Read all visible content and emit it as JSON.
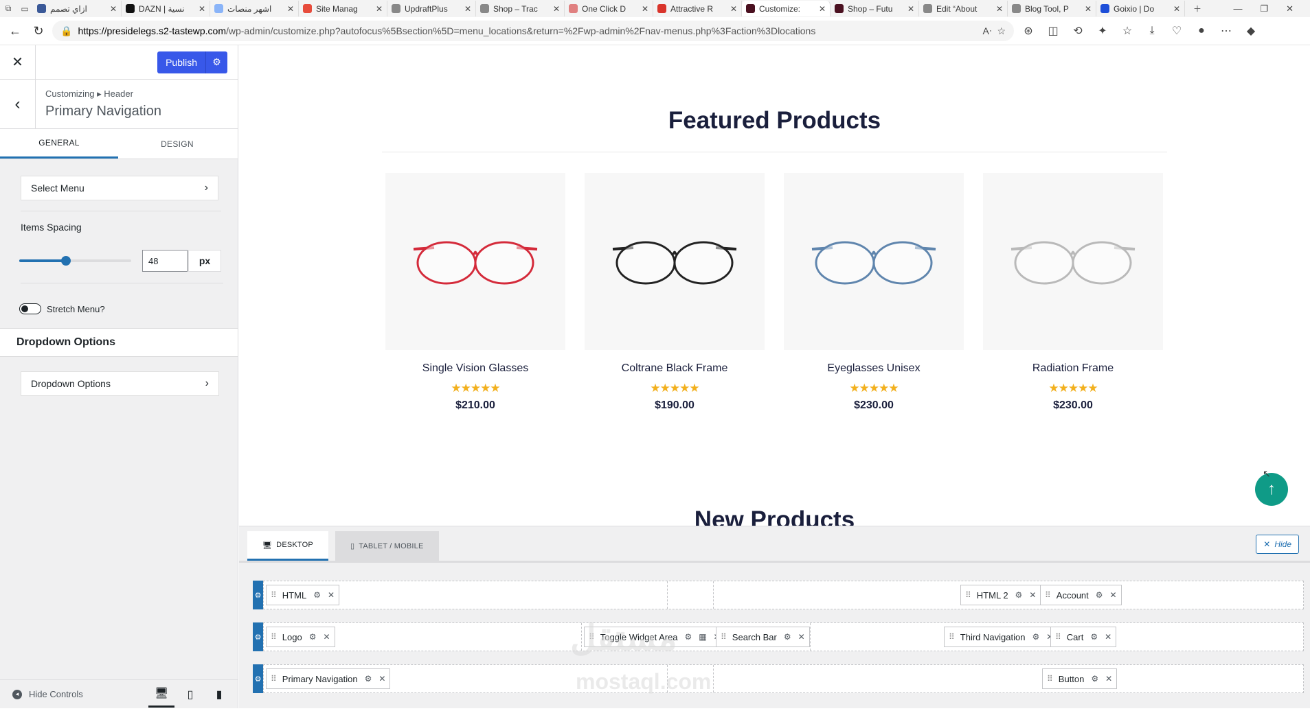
{
  "browser": {
    "tabs": [
      {
        "label": "ازاي تصمم",
        "color": "#3b5998"
      },
      {
        "label": "DAZN | نسية",
        "color": "#111111"
      },
      {
        "label": "اشهر منصات",
        "color": "#8ab4f8"
      },
      {
        "label": "Site Manag",
        "color": "#e74c3c"
      },
      {
        "label": "UpdraftPlus",
        "color": "#888888"
      },
      {
        "label": "Shop – Trac",
        "color": "#888888"
      },
      {
        "label": "One Click D",
        "color": "#e08080"
      },
      {
        "label": "Attractive R",
        "color": "#d9342b"
      },
      {
        "label": "Customize:",
        "color": "#4a1020",
        "active": true
      },
      {
        "label": "Shop – Futu",
        "color": "#4a1020"
      },
      {
        "label": "Edit “About",
        "color": "#888888"
      },
      {
        "label": "Blog Tool, P",
        "color": "#888888"
      },
      {
        "label": "Goixio | Do",
        "color": "#1d4ed8"
      }
    ],
    "url_domain": "https://presidelegs.s2-tastewp.com",
    "url_path": "/wp-admin/customize.php?autofocus%5Bsection%5D=menu_locations&return=%2Fwp-admin%2Fnav-menus.php%3Faction%3Dlocations"
  },
  "sidebar": {
    "publish_label": "Publish",
    "breadcrumb": "Customizing ▸ Header",
    "title": "Primary Navigation",
    "tabs": [
      "GENERAL",
      "DESIGN"
    ],
    "select_menu_label": "Select Menu",
    "items_spacing_label": "Items Spacing",
    "items_spacing_value": "48",
    "items_spacing_fraction": 0.42,
    "items_spacing_unit": "px",
    "stretch_label": "Stretch Menu?",
    "dropdown_heading": "Dropdown Options",
    "dropdown_button_label": "Dropdown Options",
    "hide_controls_label": "Hide Controls"
  },
  "preview": {
    "featured_heading": "Featured Products",
    "new_heading": "New Products",
    "products": [
      {
        "name": "Single Vision Glasses",
        "price": "$210.00",
        "stars": "★★★★★",
        "frame_color": "#d42a3a"
      },
      {
        "name": "Coltrane Black Frame",
        "price": "$190.00",
        "stars": "★★★★★",
        "frame_color": "#222222"
      },
      {
        "name": "Eyeglasses Unisex",
        "price": "$230.00",
        "stars": "★★★★★",
        "frame_color": "#5f85ad"
      },
      {
        "name": "Radiation Frame",
        "price": "$230.00",
        "stars": "★★★★★",
        "frame_color": "#b9b9b9"
      }
    ]
  },
  "builder": {
    "tabs": [
      "DESKTOP",
      "TABLET / MOBILE"
    ],
    "hide_label": "Hide",
    "row1": {
      "left": "HTML",
      "right1": "HTML 2",
      "right2": "Account"
    },
    "row2": {
      "left": "Logo",
      "center1": "Toggle Widget Area",
      "center2": "Search Bar",
      "right1": "Third Navigation",
      "right2": "Cart"
    },
    "row3": {
      "left": "Primary Navigation",
      "right": "Button"
    }
  },
  "watermark": {
    "arabic": "مستقل",
    "latin": "mostaql.com"
  }
}
